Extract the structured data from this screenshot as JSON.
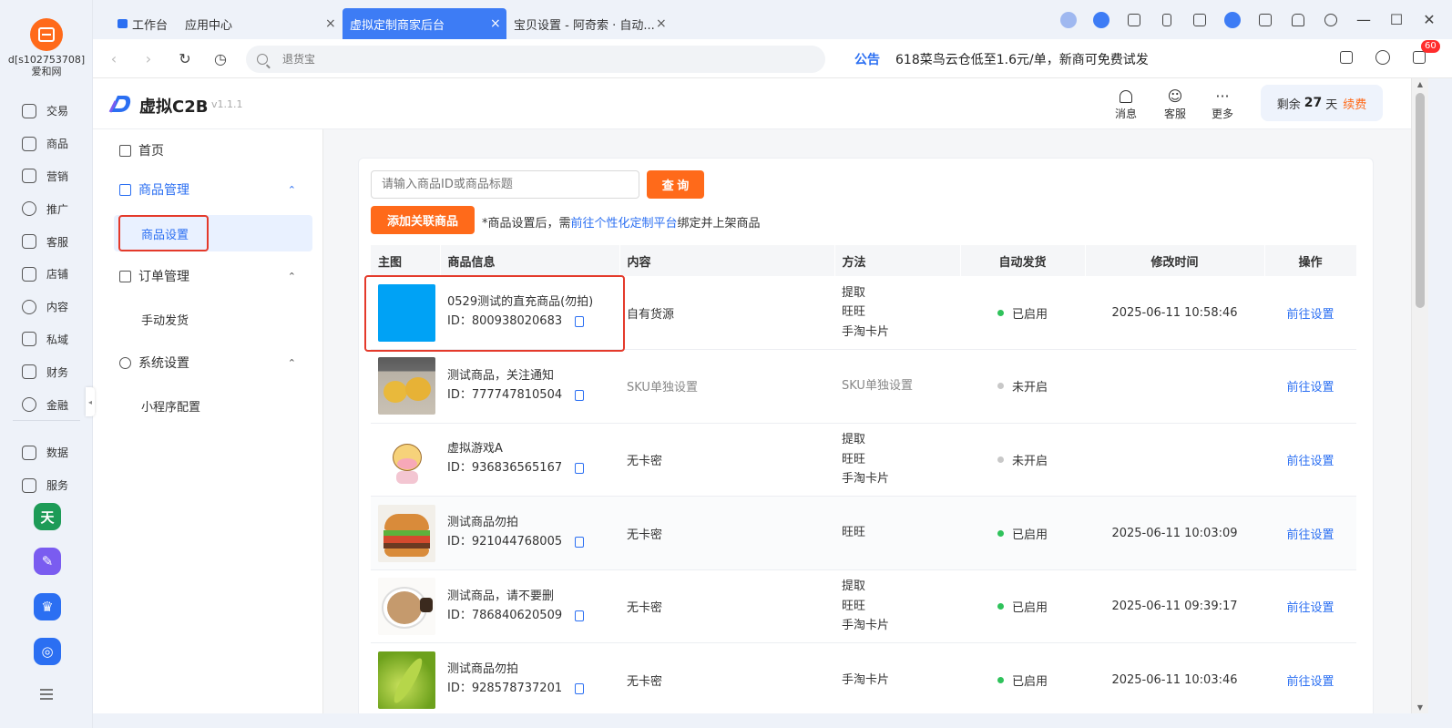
{
  "rail": {
    "account_line1": "d[s102753708]",
    "account_line2": "爱和网",
    "nav": [
      {
        "label": "交易",
        "icon": "clipboard-icon"
      },
      {
        "label": "商品",
        "icon": "bag-icon"
      },
      {
        "label": "营销",
        "icon": "megaphone-icon"
      },
      {
        "label": "推广",
        "icon": "bulb-icon"
      },
      {
        "label": "客服",
        "icon": "headset-icon"
      },
      {
        "label": "店铺",
        "icon": "store-icon"
      },
      {
        "label": "内容",
        "icon": "hash-icon"
      },
      {
        "label": "私域",
        "icon": "people-icon"
      },
      {
        "label": "财务",
        "icon": "yen-icon"
      },
      {
        "label": "金融",
        "icon": "target-icon"
      },
      {
        "label": "数据",
        "icon": "chart-icon"
      },
      {
        "label": "服务",
        "icon": "grid-icon"
      }
    ],
    "apps": [
      {
        "glyph": "天",
        "color": "#1d9b57"
      },
      {
        "glyph": "✎",
        "color": "#7a5cf0"
      },
      {
        "glyph": "♛",
        "color": "#2b6ff2"
      },
      {
        "glyph": "◎",
        "color": "#2b6ff2"
      }
    ]
  },
  "tabs": [
    {
      "label": "工作台",
      "active": false
    },
    {
      "label": "应用中心",
      "active": false
    },
    {
      "label": "虚拟定制商家后台",
      "active": true
    },
    {
      "label": "宝贝设置 - 阿奇索 · 自动...",
      "active": false
    }
  ],
  "close_glyph": "×",
  "addr": {
    "back": "‹",
    "forward": "›",
    "refresh": "↻",
    "history": "◷",
    "search_placeholder": "退货宝",
    "notice_label": "公告",
    "notice_text": "618菜鸟云仓低至1.6元/单，新商可免费试发",
    "badge": "60"
  },
  "window_controls": {
    "minimize": "—",
    "maximize": "☐",
    "close": "✕"
  },
  "app": {
    "name": "虚拟C2B",
    "version": "v1.1.1",
    "actions": [
      {
        "label": "消息",
        "icon": "bell-icon",
        "glyph": "🔔"
      },
      {
        "label": "客服",
        "icon": "service-icon",
        "glyph": "☺"
      },
      {
        "label": "更多",
        "icon": "more-icon",
        "glyph": "···"
      }
    ],
    "remain_prefix": "剩余",
    "remain_days": "27",
    "remain_suffix": "天",
    "renew": "续费"
  },
  "menu": {
    "home": "首页",
    "goods_mgmt": "商品管理",
    "goods_setting": "商品设置",
    "order_mgmt": "订单管理",
    "manual_ship": "手动发货",
    "system_setting": "系统设置",
    "mini_program": "小程序配置",
    "chevron": "⌃"
  },
  "toolbar": {
    "query_placeholder": "请输入商品ID或商品标题",
    "query_button": "查 询",
    "add_button": "添加关联商品",
    "tip_prefix": "*商品设置后，需",
    "tip_link": "前往个性化定制平台",
    "tip_suffix": "绑定并上架商品"
  },
  "table": {
    "headers": [
      "主图",
      "商品信息",
      "内容",
      "方法",
      "自动发货",
      "修改时间",
      "操作"
    ],
    "id_prefix": "ID：",
    "rows": [
      {
        "thumb": "blue",
        "name": "0529测试的直充商品(勿拍)",
        "id": "800938020683",
        "content": "自有货源",
        "content_gray": false,
        "methods": [
          "提取",
          "旺旺",
          "手淘卡片"
        ],
        "methods_gray": false,
        "status": "已启用",
        "enabled": true,
        "time": "2025-06-11 10:58:46",
        "action": "前往设置"
      },
      {
        "thumb": "oranges",
        "name": "测试商品，关注通知",
        "id": "777747810504",
        "content": "SKU单独设置",
        "content_gray": true,
        "methods": [
          "SKU单独设置"
        ],
        "methods_gray": true,
        "status": "未开启",
        "enabled": false,
        "time": "",
        "action": "前往设置"
      },
      {
        "thumb": "cow",
        "name": "虚拟游戏A",
        "id": "936836565167",
        "content": "无卡密",
        "content_gray": false,
        "methods": [
          "提取",
          "旺旺",
          "手淘卡片"
        ],
        "methods_gray": false,
        "status": "未开启",
        "enabled": false,
        "time": "",
        "action": "前往设置"
      },
      {
        "thumb": "burger",
        "name": "测试商品勿拍",
        "id": "921044768005",
        "content": "无卡密",
        "content_gray": false,
        "methods": [
          "旺旺"
        ],
        "methods_gray": false,
        "status": "已启用",
        "enabled": true,
        "time": "2025-06-11 10:03:09",
        "action": "前往设置"
      },
      {
        "thumb": "coffee",
        "name": "测试商品，请不要删",
        "id": "786840620509",
        "content": "无卡密",
        "content_gray": false,
        "methods": [
          "提取",
          "旺旺",
          "手淘卡片"
        ],
        "methods_gray": false,
        "status": "已启用",
        "enabled": true,
        "time": "2025-06-11 09:39:17",
        "action": "前往设置"
      },
      {
        "thumb": "leaf",
        "name": "测试商品勿拍",
        "id": "928578737201",
        "content": "无卡密",
        "content_gray": false,
        "methods": [
          "手淘卡片"
        ],
        "methods_gray": false,
        "status": "已启用",
        "enabled": true,
        "time": "2025-06-11 10:03:46",
        "action": "前往设置"
      }
    ]
  },
  "colors": {
    "accent": "#2b6ff2",
    "orange": "#ff6a1a",
    "tab_active": "#3d7cf5",
    "enabled": "#2fc25b",
    "disabled": "#c8c8c8",
    "highlight": "#e43a2b"
  }
}
